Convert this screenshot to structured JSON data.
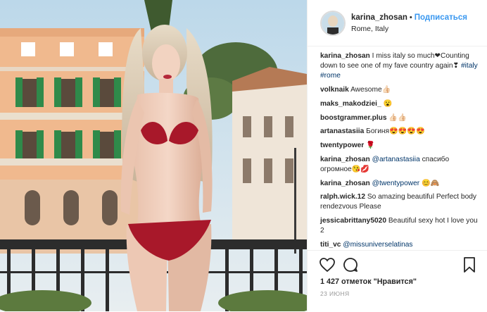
{
  "header": {
    "username": "karina_zhosan",
    "dot": "•",
    "follow_label": "Подписаться",
    "location": "Rome, Italy"
  },
  "caption": {
    "username": "karina_zhosan",
    "text": "I miss italy so much❤Counting down to see one of my fave country again❣",
    "tags": [
      "#italy",
      "#rome"
    ]
  },
  "comments": [
    {
      "user": "volknaik",
      "text": "Awesome👍🏻"
    },
    {
      "user": "maks_makodziei_",
      "text": "😮"
    },
    {
      "user": "boostgrammer.plus",
      "text": "👍🏻👍🏻"
    },
    {
      "user": "artanastasiia",
      "text": "Богиня😍😍😍😍"
    },
    {
      "user": "twentypower",
      "text": "🌹"
    },
    {
      "user": "karina_zhosan",
      "mention": "@artanastasiia",
      "text": "спасибо огромное😘💋"
    },
    {
      "user": "karina_zhosan",
      "mention": "@twentypower",
      "text": "😊🙈"
    },
    {
      "user": "ralph.wick.12",
      "text": "So amazing beautiful Perfect body rendezvous Please"
    },
    {
      "user": "jessicabrittany5020",
      "text": "Beautiful sexy hot I love you 2"
    },
    {
      "user": "titi_vc",
      "mention": "@missuniverselatinas",
      "text": ""
    }
  ],
  "likes": "1 427 отметок \"Нравится\"",
  "date": "23 июня",
  "icons": {
    "like": "heart-icon",
    "comment": "comment-icon",
    "save": "bookmark-icon"
  },
  "colors": {
    "link": "#3897f0",
    "mention": "#003569",
    "text": "#262626",
    "muted": "#999999",
    "border": "#efefef"
  }
}
